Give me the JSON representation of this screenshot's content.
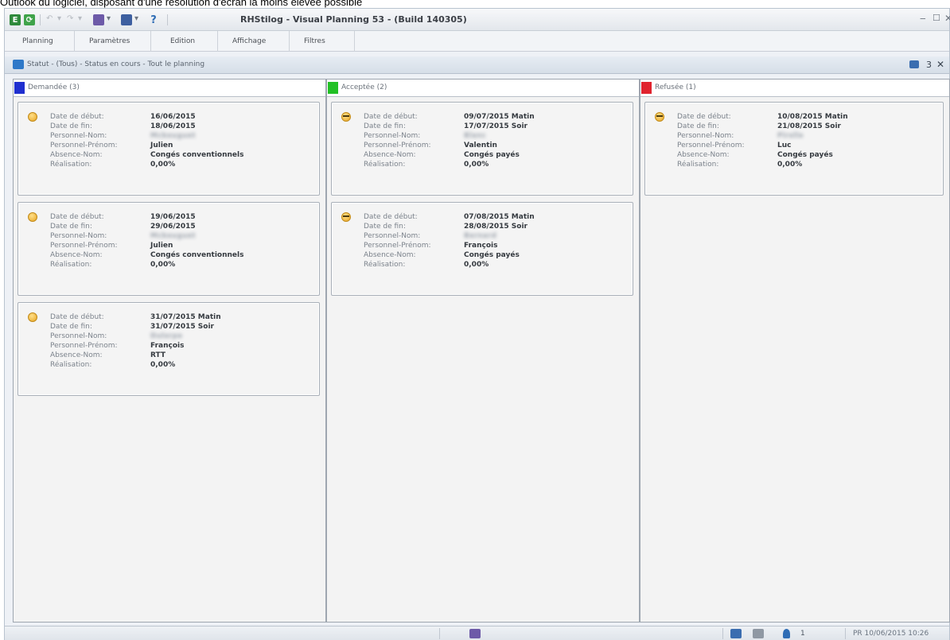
{
  "page_caption": "Outlook du logiciel, disposant d'une résolution d'écran la moins élevée possible",
  "app": {
    "title": "RHStilog - Visual Planning 53 - (Build 140305)",
    "quick_access": {
      "help_label": "?"
    }
  },
  "menu": {
    "items": [
      "Planning",
      "Paramètres",
      "Edition",
      "Affichage",
      "Filtres"
    ]
  },
  "info_bar": {
    "text": "Statut - (Tous) - Status en cours - Tout le planning",
    "count": "3"
  },
  "columns": [
    {
      "title": "Demandée (3)",
      "color": "#1f2fcf",
      "cards": [
        {
          "fields": [
            {
              "label": "Date de début:",
              "value": "16/06/2015"
            },
            {
              "label": "Date de fin:",
              "value": "18/06/2015"
            },
            {
              "label": "Personnel-Nom:",
              "value": "Mcbouguet",
              "blurred": true
            },
            {
              "label": "Personnel-Prénom:",
              "value": "Julien"
            },
            {
              "label": "Absence-Nom:",
              "value": "Congés conventionnels"
            },
            {
              "label": "Réalisation:",
              "value": "0,00%"
            }
          ]
        },
        {
          "fields": [
            {
              "label": "Date de début:",
              "value": "19/06/2015"
            },
            {
              "label": "Date de fin:",
              "value": "29/06/2015"
            },
            {
              "label": "Personnel-Nom:",
              "value": "Mcbouguet",
              "blurred": true
            },
            {
              "label": "Personnel-Prénom:",
              "value": "Julien"
            },
            {
              "label": "Absence-Nom:",
              "value": "Congés conventionnels"
            },
            {
              "label": "Réalisation:",
              "value": "0,00%"
            }
          ]
        },
        {
          "fields": [
            {
              "label": "Date de début:",
              "value": "31/07/2015 Matin"
            },
            {
              "label": "Date de fin:",
              "value": "31/07/2015 Soir"
            },
            {
              "label": "Personnel-Nom:",
              "value": "Dulorpe",
              "blurred": true
            },
            {
              "label": "Personnel-Prénom:",
              "value": "François"
            },
            {
              "label": "Absence-Nom:",
              "value": "RTT"
            },
            {
              "label": "Réalisation:",
              "value": "0,00%"
            }
          ]
        }
      ]
    },
    {
      "title": "Acceptée (2)",
      "color": "#22c025",
      "cards": [
        {
          "fields": [
            {
              "label": "Date de début:",
              "value": "09/07/2015 Matin"
            },
            {
              "label": "Date de fin:",
              "value": "17/07/2015 Soir"
            },
            {
              "label": "Personnel-Nom:",
              "value": "Blanc",
              "blurred": true
            },
            {
              "label": "Personnel-Prénom:",
              "value": "Valentin"
            },
            {
              "label": "Absence-Nom:",
              "value": "Congés payés"
            },
            {
              "label": "Réalisation:",
              "value": "0,00%"
            }
          ]
        },
        {
          "fields": [
            {
              "label": "Date de début:",
              "value": "07/08/2015 Matin"
            },
            {
              "label": "Date de fin:",
              "value": "28/08/2015 Soir"
            },
            {
              "label": "Personnel-Nom:",
              "value": "Bernard",
              "blurred": true
            },
            {
              "label": "Personnel-Prénom:",
              "value": "François"
            },
            {
              "label": "Absence-Nom:",
              "value": "Congés payés"
            },
            {
              "label": "Réalisation:",
              "value": "0,00%"
            }
          ]
        }
      ]
    },
    {
      "title": "Refusée (1)",
      "color": "#e0232e",
      "cards": [
        {
          "fields": [
            {
              "label": "Date de début:",
              "value": "10/08/2015 Matin"
            },
            {
              "label": "Date de fin:",
              "value": "21/08/2015 Soir"
            },
            {
              "label": "Personnel-Nom:",
              "value": "Pirolle",
              "blurred": true
            },
            {
              "label": "Personnel-Prénom:",
              "value": "Luc"
            },
            {
              "label": "Absence-Nom:",
              "value": "Congés payés"
            },
            {
              "label": "Réalisation:",
              "value": "0,00%"
            }
          ]
        }
      ]
    }
  ],
  "status_bar": {
    "user_count": "1",
    "datetime": "PR 10/06/2015 10:26"
  }
}
